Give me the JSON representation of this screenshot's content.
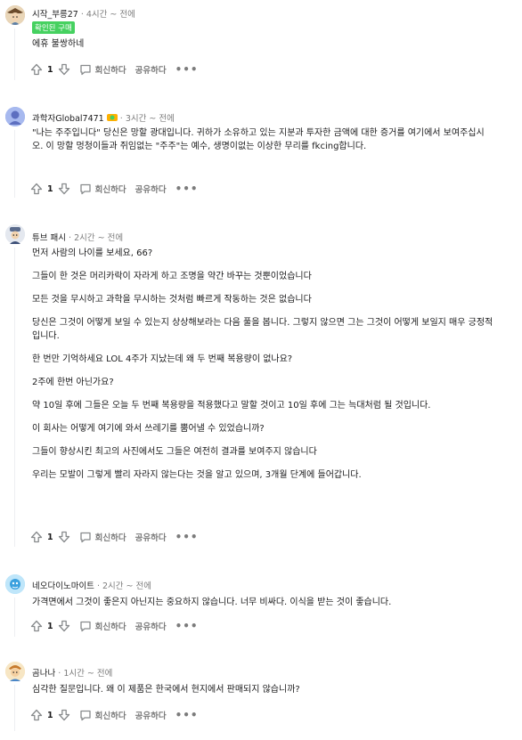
{
  "actions": {
    "reply": "회신하다",
    "share": "공유하다",
    "more": "•••"
  },
  "comments": [
    {
      "author": "시작_부릉27",
      "time": "4시간 ~ 전에",
      "badge": "확인된 구매",
      "paragraphs": [
        "에휴 불쌍하네"
      ],
      "votes": "1"
    },
    {
      "author": "과학자Global7471",
      "time": "3시간 ~ 전에",
      "paragraphs": [
        "\"나는 주주입니다\" 당신은 망할 광대입니다. 귀하가 소유하고 있는 지분과 투자한 금액에 대한 증거를 여기에서 보여주십시오. 이 망할 멍청이들과 쥐임없는 \"주주\"는 예수, 생명이없는 이상한 무리를 fkcing합니다."
      ],
      "votes": "1"
    },
    {
      "author": "튜브 패시",
      "time": "2시간 ~ 전에",
      "paragraphs": [
        "먼저 사람의 나이를 보세요, 66?",
        "그들이 한 것은 머리카락이 자라게 하고 조명을 약간 바꾸는 것뿐이었습니다",
        "모든 것을 무시하고 과학을 무시하는 것처럼 빠르게 작동하는 것은 없습니다",
        "당신은 그것이 어떻게 보일 수 있는지 상상해보라는 다음 풀을 봅니다. 그렇지 않으면 그는 그것이 어떻게 보일지 매우 긍정적입니다.",
        "한 번만 기억하세요 LOL 4주가 지났는데 왜 두 번째 복용량이 없나요?",
        "2주에 한번 아닌가요?",
        "약 10일 후에 그들은 오늘 두 번째 복용량을 적용했다고 말할 것이고 10일 후에 그는 늑대처럼 될 것입니다.",
        "이 회사는 어떻게 여기에 와서 쓰레기를 뿜어낼 수 있었습니까?",
        "그들이 향상시킨 최고의 사진에서도 그들은 여전히 결과를 보여주지 않습니다",
        "우리는 모발이 그렇게 빨리 자라지 않는다는 것을 알고 있으며, 3개월 단계에 들어갑니다."
      ],
      "votes": "1"
    },
    {
      "author": "네오다이노마이트",
      "time": "2시간 ~ 전에",
      "paragraphs": [
        "가격면에서 그것이 좋은지 아닌지는 중요하지 않습니다. 너무 비싸다. 이식을 받는 것이 좋습니다."
      ],
      "votes": "1"
    },
    {
      "author": "곰나나",
      "time": "1시간 ~ 전에",
      "paragraphs": [
        "심각한 질문입니다. 왜 이 제품은 한국에서 현지에서 판매되지 않습니까?"
      ],
      "votes": "1"
    }
  ]
}
